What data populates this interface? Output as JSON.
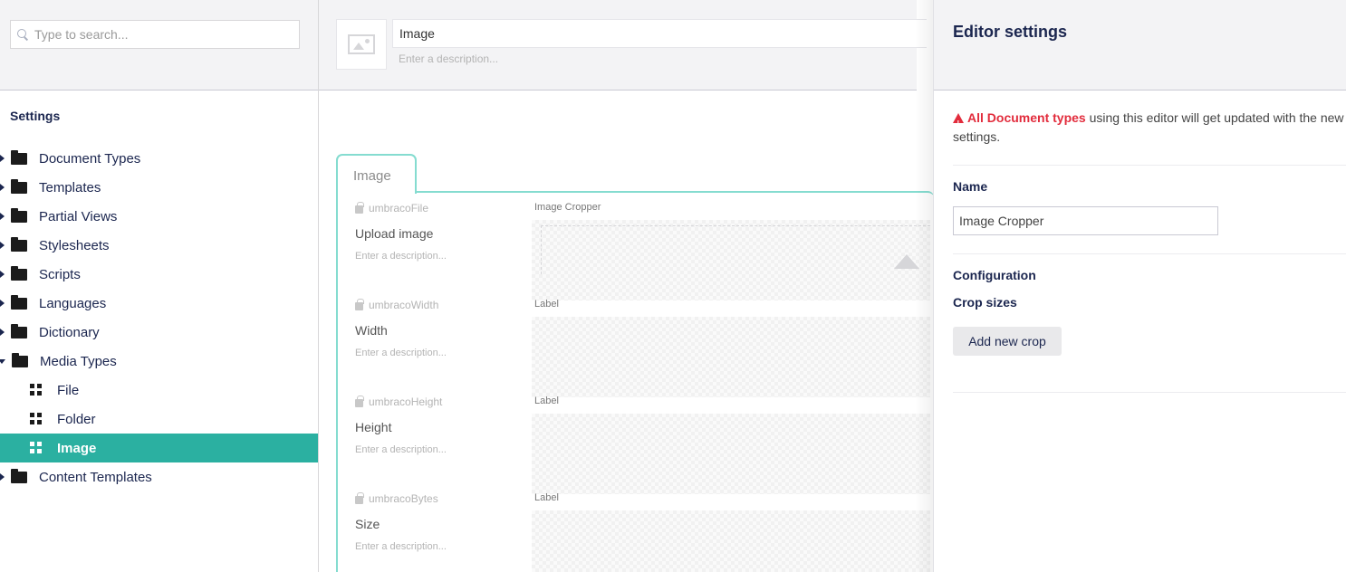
{
  "sidebar": {
    "search_placeholder": "Type to search...",
    "section_title": "Settings",
    "items": [
      {
        "label": "Document Types"
      },
      {
        "label": "Templates"
      },
      {
        "label": "Partial Views"
      },
      {
        "label": "Stylesheets"
      },
      {
        "label": "Scripts"
      },
      {
        "label": "Languages"
      },
      {
        "label": "Dictionary"
      },
      {
        "label": "Media Types"
      },
      {
        "label": "File"
      },
      {
        "label": "Folder"
      },
      {
        "label": "Image"
      },
      {
        "label": "Content Templates"
      }
    ]
  },
  "main": {
    "name_value": "Image",
    "description_placeholder": "Enter a description...",
    "tab_label": "Image",
    "properties": [
      {
        "alias": "umbracoFile",
        "label": "Upload image",
        "description": "Enter a description...",
        "editor": "Image Cropper"
      },
      {
        "alias": "umbracoWidth",
        "label": "Width",
        "description": "Enter a description...",
        "editor": "Label"
      },
      {
        "alias": "umbracoHeight",
        "label": "Height",
        "description": "Enter a description...",
        "editor": "Label"
      },
      {
        "alias": "umbracoBytes",
        "label": "Size",
        "description": "Enter a description...",
        "editor": "Label"
      }
    ]
  },
  "panel": {
    "title": "Editor settings",
    "warning_strong": "All Document types",
    "warning_rest": " using this editor will get updated with the new settings.",
    "name_label": "Name",
    "name_value": "Image Cropper",
    "configuration_label": "Configuration",
    "crop_sizes_label": "Crop sizes",
    "add_crop_label": "Add new crop"
  },
  "colors": {
    "accent": "#2bb0a1",
    "tab_border": "#85dcd0",
    "warning": "#e22c3c"
  }
}
